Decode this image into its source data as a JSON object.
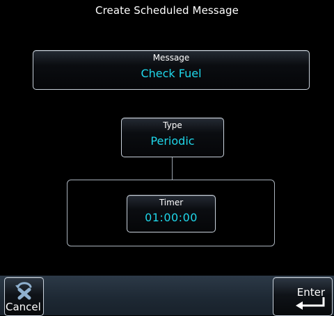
{
  "header": {
    "title": "Create Scheduled Message"
  },
  "fields": {
    "message": {
      "label": "Message",
      "value": "Check Fuel"
    },
    "type": {
      "label": "Type",
      "value": "Periodic"
    },
    "timer": {
      "label": "Timer",
      "value": "01:00:00"
    }
  },
  "softkeys": {
    "cancel": {
      "label": "Cancel",
      "icon": "cancel-icon"
    },
    "enter": {
      "label": "Enter",
      "icon": "enter-arrow-icon"
    }
  },
  "colors": {
    "value_text": "#1fd7ea",
    "label_text": "#ffffff",
    "background": "#000000",
    "bottom_bar": "#1d2833"
  }
}
